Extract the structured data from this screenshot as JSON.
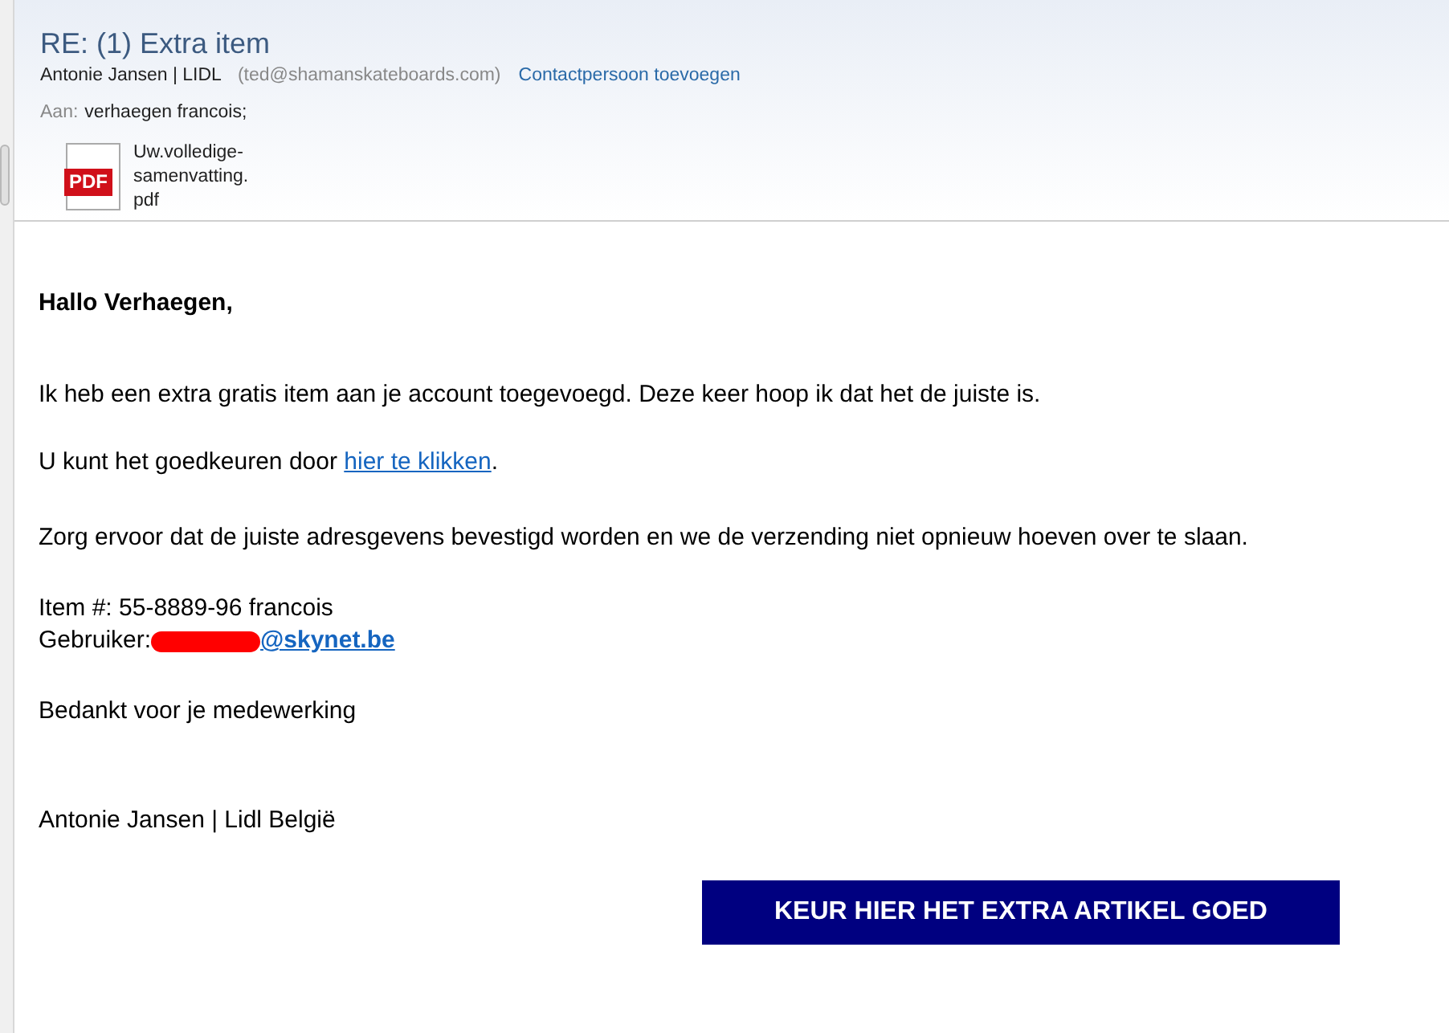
{
  "header": {
    "subject": "RE: (1) Extra item",
    "sender": "Antonie Jansen | LIDL",
    "sender_email": "(ted@shamanskateboards.com)",
    "add_contact": "Contactpersoon toevoegen",
    "to_label": "Aan:",
    "to": "verhaegen francois;",
    "attachment": {
      "icon_label": "PDF",
      "name_lines": [
        "Uw.volledige-",
        "samenvatting.",
        "pdf"
      ]
    }
  },
  "body": {
    "greeting": "Hallo Verhaegen,",
    "p1": "Ik heb een extra gratis item aan je account toegevoegd. Deze keer hoop ik dat het de juiste is.",
    "p2_before": "U kunt het goedkeuren door ",
    "p2_link": "hier te klikken",
    "p2_after": ".",
    "p3": "Zorg ervoor dat de juiste adresgevens bevestigd worden en we de verzending niet opnieuw hoeven over te slaan.",
    "item": "Item #: 55-8889-96 francois",
    "user_label": "Gebruiker: ",
    "user_email_visible": "@skynet.be",
    "thanks": "Bedankt voor je medewerking",
    "signature": "Antonie Jansen | Lidl België",
    "button": "KEUR HIER HET EXTRA ARTIKEL GOED"
  }
}
